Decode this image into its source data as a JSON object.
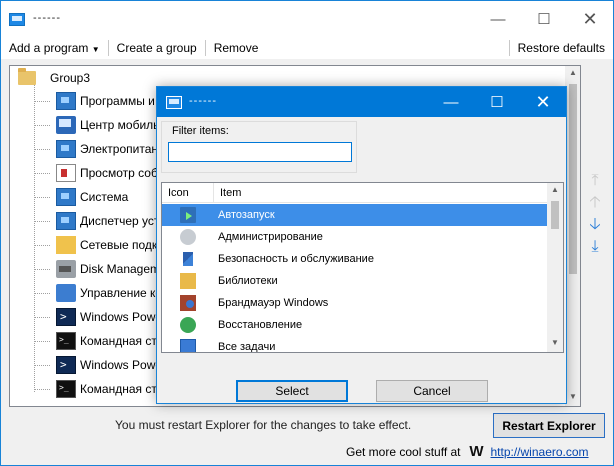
{
  "main": {
    "title": "------",
    "menu": {
      "add_program": "Add a program",
      "create_group": "Create a group",
      "remove": "Remove",
      "restore_defaults": "Restore defaults"
    },
    "tree": {
      "group": "Group3",
      "items": [
        {
          "label": "Программы и ко",
          "icon": "control-panel-icon"
        },
        {
          "label": "Центр мобильно",
          "icon": "mobility-center-icon"
        },
        {
          "label": "Электропитание",
          "icon": "power-options-icon"
        },
        {
          "label": "Просмотр событ",
          "icon": "event-viewer-icon"
        },
        {
          "label": "Система",
          "icon": "system-icon"
        },
        {
          "label": "Диспетчер устро",
          "icon": "device-manager-icon"
        },
        {
          "label": "Сетевые подклю",
          "icon": "network-connections-icon"
        },
        {
          "label": "Disk Management",
          "icon": "disk-management-icon"
        },
        {
          "label": "Управление комп",
          "icon": "computer-management-icon"
        },
        {
          "label": "Windows PowerSh",
          "icon": "powershell-icon"
        },
        {
          "label": "Командная строк",
          "icon": "command-prompt-icon"
        },
        {
          "label": "Windows PowerSh",
          "icon": "powershell-icon"
        },
        {
          "label": "Командная строк",
          "icon": "command-prompt-icon"
        }
      ]
    },
    "status_message": "You must restart Explorer for the changes to take effect.",
    "restart_button": "Restart Explorer",
    "footer": {
      "text": "Get more cool stuff at",
      "logo": "W",
      "link": "http://winaero.com"
    }
  },
  "dialog": {
    "title": "------",
    "filter_label": "Filter items:",
    "filter_value": "",
    "columns": {
      "icon": "Icon",
      "item": "Item"
    },
    "items": [
      {
        "label": "Автозапуск",
        "icon": "autoplay-icon",
        "selected": true
      },
      {
        "label": "Администрирование",
        "icon": "administrative-tools-icon",
        "selected": false
      },
      {
        "label": "Безопасность и обслуживание",
        "icon": "security-maintenance-icon",
        "selected": false
      },
      {
        "label": "Библиотеки",
        "icon": "libraries-icon",
        "selected": false
      },
      {
        "label": "Брандмауэр Windows",
        "icon": "windows-firewall-icon",
        "selected": false
      },
      {
        "label": "Восстановление",
        "icon": "recovery-icon",
        "selected": false
      },
      {
        "label": "Все задачи",
        "icon": "all-tasks-icon",
        "selected": false
      }
    ],
    "select_button": "Select",
    "cancel_button": "Cancel"
  },
  "colors": {
    "accent": "#0078d7",
    "selection": "#3d8ee8",
    "link": "#0645ad"
  }
}
